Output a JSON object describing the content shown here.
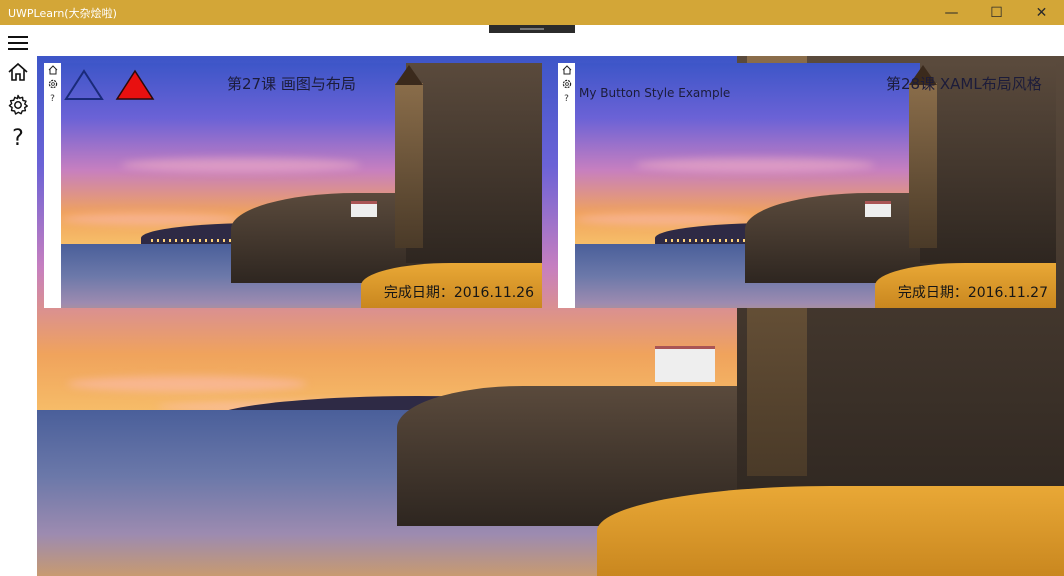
{
  "window": {
    "title": "UWPLearn(大杂烩啦)",
    "minimize_glyph": "—",
    "maximize_glyph": "☐",
    "close_glyph": "✕"
  },
  "nav": {
    "items": [
      {
        "name": "hamburger-menu-icon"
      },
      {
        "name": "home-icon"
      },
      {
        "name": "settings-gear-icon"
      },
      {
        "name": "help-question-icon",
        "glyph": "?"
      }
    ]
  },
  "tiles": [
    {
      "title": "第27课 画图与布局",
      "date": "完成日期：2016.11.26",
      "mini_help": "?",
      "triangle_colors": {
        "outline": "#1a2a7a",
        "filled": "#e81010"
      }
    },
    {
      "title": "第28课 XAML布局风格",
      "subtitle": "My Button Style Example",
      "date": "完成日期：2016.11.27",
      "mini_help": "?"
    }
  ],
  "colors": {
    "titlebar": "#d3a637",
    "accent_red": "#e81010",
    "accent_navy": "#1a2a7a"
  }
}
